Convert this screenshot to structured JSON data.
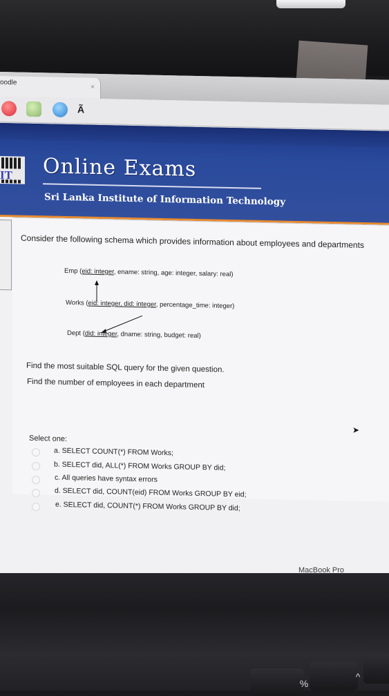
{
  "browser": {
    "tab_title": "oodle",
    "tab_close": "×",
    "toolbar_glyph": "Ã"
  },
  "header": {
    "logo_text": "IT",
    "title": "Online Exams",
    "subtitle": "Sri Lanka Institute of Information Technology"
  },
  "question": {
    "prompt": "Consider the following schema which provides information about employees and departments",
    "schema": {
      "emp_prefix": "Emp (",
      "emp_key": "eid: integer",
      "emp_rest": ", ename: string, age: integer, salary: real)",
      "works_prefix": "Works (",
      "works_key": "eid: integer, did: integer",
      "works_rest": ", percentage_time: integer)",
      "dept_prefix": "Dept (",
      "dept_key": "did: integer",
      "dept_rest": ", dname: string, budget: real)"
    },
    "instruction": "Find the most suitable SQL query for the given question.",
    "task": "Find the number of employees in each department",
    "select_label": "Select one:",
    "options": [
      {
        "label": "a. SELECT COUNT(*) FROM Works;"
      },
      {
        "label": "b. SELECT did, ALL(*) FROM Works GROUP BY did;"
      },
      {
        "label": "c. All queries have syntax errors"
      },
      {
        "label": "d. SELECT did, COUNT(eid) FROM Works GROUP BY eid;"
      },
      {
        "label": "e. SELECT did, COUNT(*) FROM Works GROUP BY did;"
      }
    ]
  },
  "device": {
    "brand_label": "MacBook Pro",
    "keys": [
      "%",
      "^",
      "&"
    ]
  }
}
